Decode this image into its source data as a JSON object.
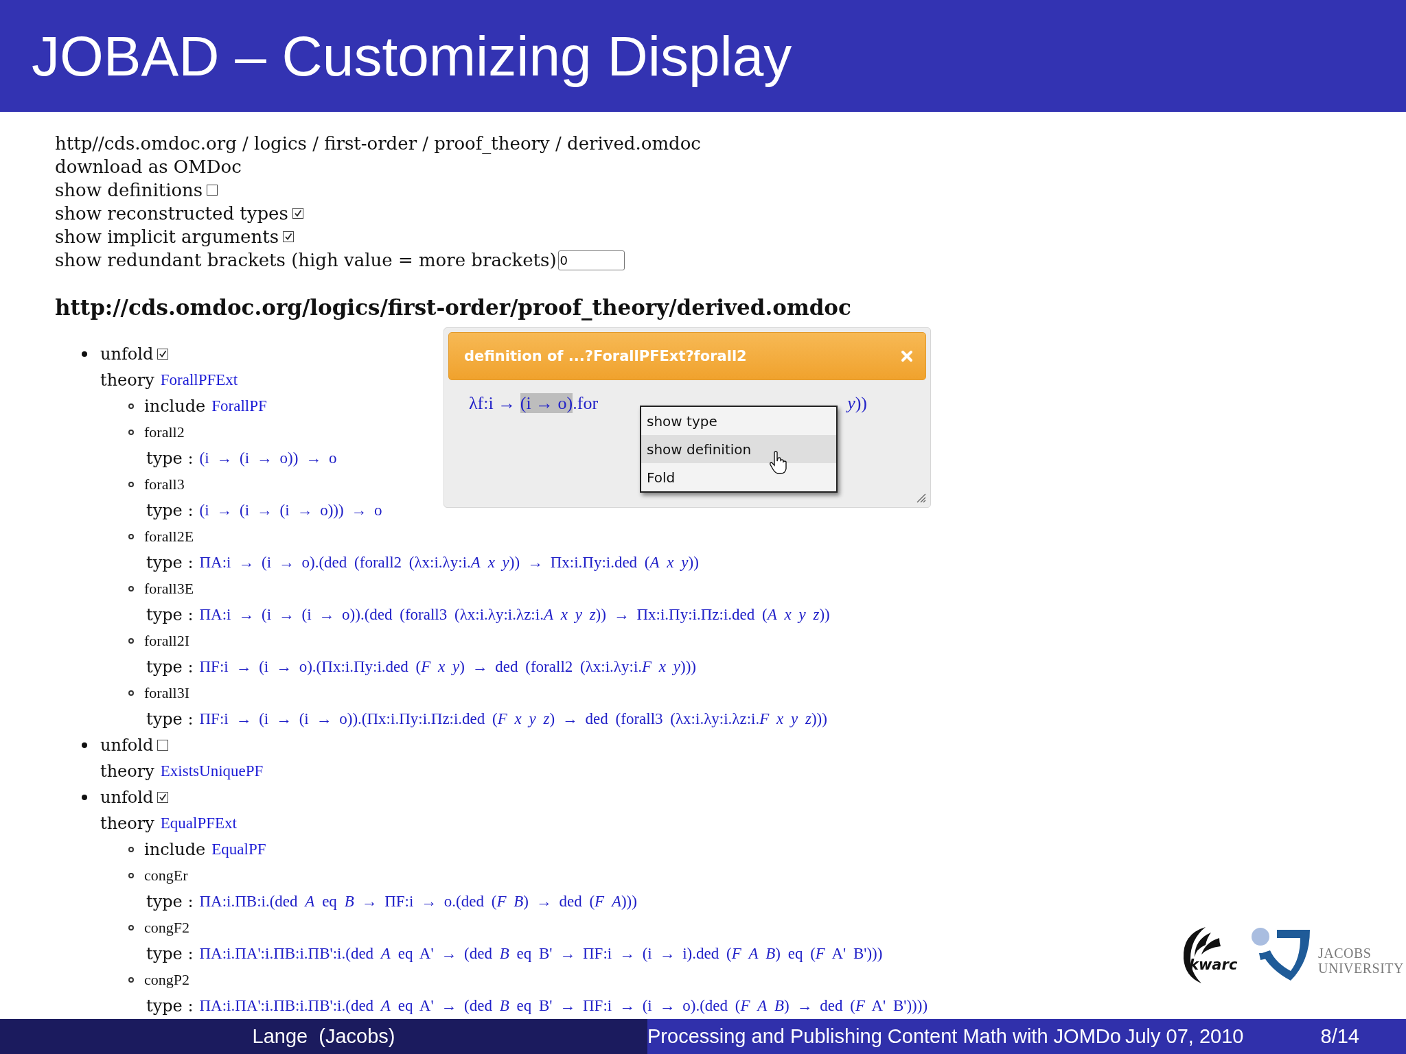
{
  "slide": {
    "title": "JOBAD – Customizing Display"
  },
  "page": {
    "breadcrumb": "http//cds.omdoc.org / logics / first-order / proof_theory / derived.omdoc",
    "download": "download as OMDoc",
    "options": [
      {
        "kind": "checkbox",
        "label": "show definitions",
        "checked": false
      },
      {
        "kind": "checkbox",
        "label": "show reconstructed types",
        "checked": true
      },
      {
        "kind": "checkbox",
        "label": "show implicit arguments",
        "checked": true
      },
      {
        "kind": "number",
        "label": "show redundant brackets (high value = more brackets)",
        "value": "0"
      }
    ],
    "heading": "http://cds.omdoc.org/logics/first-order/proof_theory/derived.omdoc"
  },
  "theories": [
    {
      "toggle_label": "unfold",
      "unfolded": true,
      "theory_label": "theory",
      "theory_name": "ForallPFExt",
      "children": [
        {
          "kind": "include",
          "label": "include",
          "name": "ForallPF"
        },
        {
          "kind": "symbol",
          "name": "forall2",
          "type_label": "type :",
          "type": "(i → (i → o)) → o"
        },
        {
          "kind": "symbol",
          "name": "forall3",
          "type_label": "type :",
          "type": "(i → (i → (i → o))) → o"
        },
        {
          "kind": "symbol",
          "name": "forall2E",
          "type_label": "type :",
          "type": "ΠA:i → (i → o).(ded (forall2 (λx:i.λy:i.*A* *x* *y*)) → Πx:i.Πy:i.ded (*A* *x* *y*))"
        },
        {
          "kind": "symbol",
          "name": "forall3E",
          "type_label": "type :",
          "type": "ΠA:i → (i → (i → o)).(ded (forall3 (λx:i.λy:i.λz:i.*A* *x* *y* *z*)) → Πx:i.Πy:i.Πz:i.ded (*A* *x* *y* *z*))"
        },
        {
          "kind": "symbol",
          "name": "forall2I",
          "type_label": "type :",
          "type": "ΠF:i → (i → o).(Πx:i.Πy:i.ded (*F* *x* *y*) → ded (forall2 (λx:i.λy:i.*F* *x* *y*)))"
        },
        {
          "kind": "symbol",
          "name": "forall3I",
          "type_label": "type :",
          "type": "ΠF:i → (i → (i → o)).(Πx:i.Πy:i.Πz:i.ded (*F* *x* *y* *z*) → ded (forall3 (λx:i.λy:i.λz:i.*F* *x* *y* *z*)))"
        }
      ]
    },
    {
      "toggle_label": "unfold",
      "unfolded": false,
      "theory_label": "theory",
      "theory_name": "ExistsUniquePF"
    },
    {
      "toggle_label": "unfold",
      "unfolded": true,
      "theory_label": "theory",
      "theory_name": "EqualPFExt",
      "children": [
        {
          "kind": "include",
          "label": "include",
          "name": "EqualPF"
        },
        {
          "kind": "symbol",
          "name": "congEr",
          "type_label": "type :",
          "type": "ΠA:i.ΠB:i.(ded *A* eq *B* → ΠF:i → o.(ded (*F* *B*) → ded (*F* *A*)))"
        },
        {
          "kind": "symbol",
          "name": "congF2",
          "type_label": "type :",
          "type": "ΠA:i.ΠA':i.ΠB:i.ΠB':i.(ded *A* eq A' → (ded *B* eq B' → ΠF:i → (i → i).ded (*F* *A* *B*) eq (*F* A' B')))"
        },
        {
          "kind": "symbol",
          "name": "congP2",
          "type_label": "type :",
          "type": "ΠA:i.ΠA':i.ΠB:i.ΠB':i.(ded *A* eq A' → (ded *B* eq B' → ΠF:i → (i → o).(ded (*F* *A* *B*) → ded (*F* A' B'))))"
        }
      ]
    }
  ],
  "popup": {
    "title": "definition of ...?ForallPFExt?forall2",
    "formula": [
      {
        "text": "λf:i → ",
        "highlighted": false
      },
      {
        "text": "(i → o)",
        "highlighted": true
      },
      {
        "text": ".for",
        "highlighted": false
      }
    ],
    "formula_tail": "*y*))",
    "menu": [
      {
        "label": "show type",
        "selected": false
      },
      {
        "label": "show definition",
        "selected": true
      },
      {
        "label": "Fold",
        "selected": false
      }
    ]
  },
  "logos": {
    "kwarc": "kwarc",
    "university": [
      "JACOBS",
      "UNIVERSITY"
    ]
  },
  "footer": {
    "author": "Lange  (Jacobs)",
    "talk_title": "Processing and Publishing Content Math with JOMDo",
    "date": "July 07, 2010",
    "page": "8/14"
  }
}
